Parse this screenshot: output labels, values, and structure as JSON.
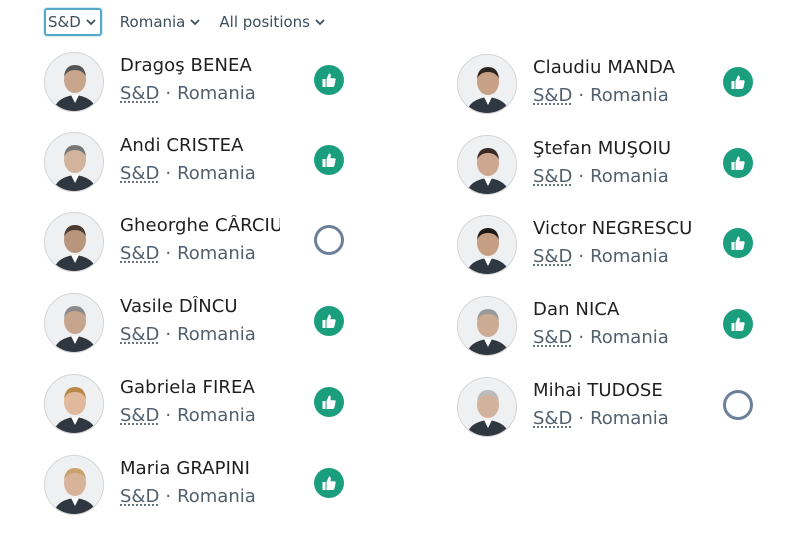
{
  "filters": [
    {
      "label": "S&D",
      "selected": true,
      "icon": "chevron-down-icon"
    },
    {
      "label": "Romania",
      "selected": false,
      "icon": "chevron-down-icon"
    },
    {
      "label": "All positions",
      "selected": false,
      "icon": "chevron-down-icon"
    }
  ],
  "colors": {
    "vote_for": "#1b9e7e",
    "did_not_vote": "#6b8199",
    "filter_border": "#56a8c9"
  },
  "members_left": [
    {
      "name": "Dragoş BENEA",
      "group": "S&D",
      "separator": "·",
      "country": "Romania",
      "position": "for",
      "icon": "thumb-up-icon"
    },
    {
      "name": "Andi CRISTEA",
      "group": "S&D",
      "separator": "·",
      "country": "Romania",
      "position": "for",
      "icon": "thumb-up-icon"
    },
    {
      "name": "Gheorghe CÂRCIU",
      "group": "S&D",
      "separator": "·",
      "country": "Romania",
      "position": "did-not-vote",
      "icon": "empty-circle-icon"
    },
    {
      "name": "Vasile DÎNCU",
      "group": "S&D",
      "separator": "·",
      "country": "Romania",
      "position": "for",
      "icon": "thumb-up-icon"
    },
    {
      "name": "Gabriela FIREA",
      "group": "S&D",
      "separator": "·",
      "country": "Romania",
      "position": "for",
      "icon": "thumb-up-icon"
    },
    {
      "name": "Maria GRAPINI",
      "group": "S&D",
      "separator": "·",
      "country": "Romania",
      "position": "for",
      "icon": "thumb-up-icon"
    }
  ],
  "members_right": [
    {
      "name": "Claudiu MANDA",
      "group": "S&D",
      "separator": "·",
      "country": "Romania",
      "position": "for",
      "icon": "thumb-up-icon"
    },
    {
      "name": "Ştefan MUŞOIU",
      "group": "S&D",
      "separator": "·",
      "country": "Romania",
      "position": "for",
      "icon": "thumb-up-icon"
    },
    {
      "name": "Victor NEGRESCU",
      "group": "S&D",
      "separator": "·",
      "country": "Romania",
      "position": "for",
      "icon": "thumb-up-icon"
    },
    {
      "name": "Dan NICA",
      "group": "S&D",
      "separator": "·",
      "country": "Romania",
      "position": "for",
      "icon": "thumb-up-icon"
    },
    {
      "name": "Mihai TUDOSE",
      "group": "S&D",
      "separator": "·",
      "country": "Romania",
      "position": "did-not-vote",
      "icon": "empty-circle-icon"
    }
  ]
}
